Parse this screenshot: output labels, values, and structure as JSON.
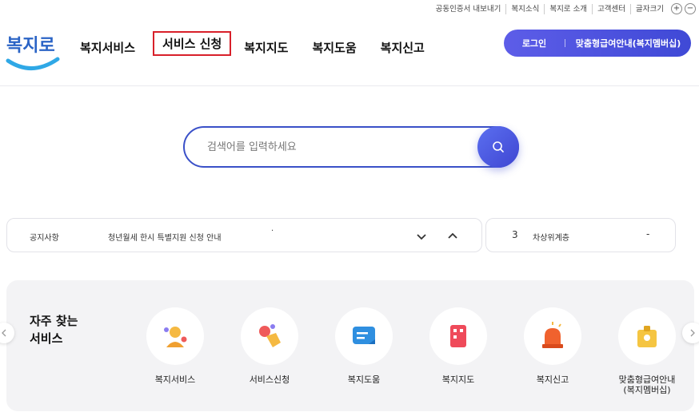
{
  "util_links": [
    "공동인증서 내보내기",
    "복지소식",
    "복지로 소개",
    "고객센터",
    "글자크기"
  ],
  "util_plus": "+",
  "util_minus": "−",
  "logo_text": "복지로",
  "gnb": [
    "복지서비스",
    "서비스 신청",
    "복지지도",
    "복지도움",
    "복지신고"
  ],
  "header_actions": {
    "login": "로그인",
    "member": "맞춤형급여안내(복지멤버십)"
  },
  "search": {
    "placeholder": "검색어를 입력하세요",
    "value": ""
  },
  "notice": {
    "label": "공지사항",
    "text": "청년월세 한시 특별지원 신청 안내",
    "dot": "·"
  },
  "rank": {
    "num": "3",
    "text": "차상위계층",
    "dash": "-"
  },
  "quick": {
    "title": "자주 찾는\n서비스",
    "items": [
      {
        "label": "복지서비스",
        "icon": "person-icon"
      },
      {
        "label": "서비스신청",
        "icon": "hand-click-icon"
      },
      {
        "label": "복지도움",
        "icon": "chat-icon"
      },
      {
        "label": "복지지도",
        "icon": "map-icon"
      },
      {
        "label": "복지신고",
        "icon": "siren-icon"
      },
      {
        "label": "맞춤형급여안내\n(복지멤버십)",
        "icon": "membership-icon"
      }
    ]
  },
  "colors": {
    "accent": "#3f49d6",
    "highlight": "#d8202a",
    "quick_bg": "#f3f3f5"
  }
}
